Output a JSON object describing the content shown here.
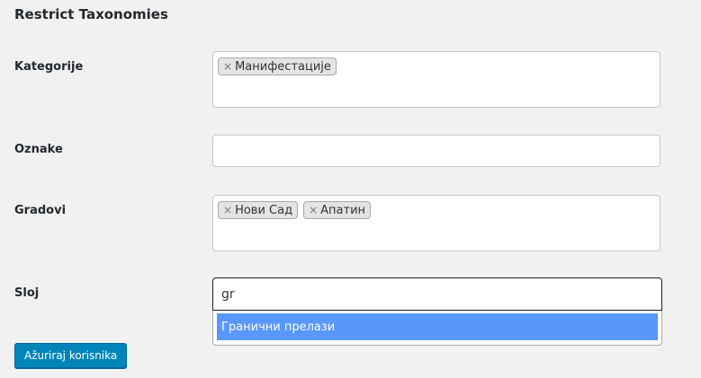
{
  "section": {
    "title": "Restrict Taxonomies"
  },
  "fields": {
    "kategorije": {
      "label": "Kategorije",
      "chips": [
        "Манифестације"
      ]
    },
    "oznake": {
      "label": "Oznake"
    },
    "gradovi": {
      "label": "Gradovi",
      "chips": [
        "Нови Сад",
        "Апатин"
      ]
    },
    "sloj": {
      "label": "Sloj",
      "search_value": "gr",
      "results": [
        "Гранични прелази"
      ]
    }
  },
  "chip_remove_glyph": "×",
  "submit": {
    "label": "Ažuriraj korisnika"
  },
  "colors": {
    "accent": "#0085ba",
    "highlight": "#5897fb"
  }
}
